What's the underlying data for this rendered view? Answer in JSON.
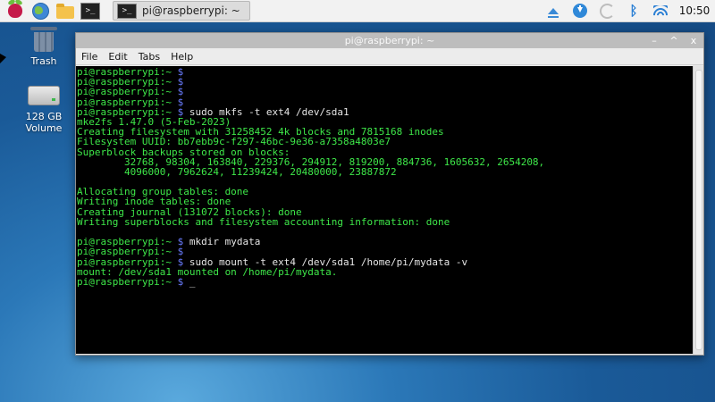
{
  "taskbar": {
    "launchers": [
      "raspberry-pi-menu",
      "web-browser",
      "file-manager",
      "terminal"
    ],
    "task_button_label": "pi@raspberrypi: ~",
    "terminal_glyph": ">_",
    "clock": "10:50"
  },
  "desktop": {
    "trash_label": "Trash",
    "volume_label_line1": "128 GB",
    "volume_label_line2": "Volume"
  },
  "window": {
    "title": "pi@raspberrypi: ~",
    "controls": [
      "–",
      "^",
      "x"
    ],
    "menu": [
      "File",
      "Edit",
      "Tabs",
      "Help"
    ]
  },
  "terminal": {
    "lines": [
      {
        "prompt": "pi@raspberrypi:~ ",
        "dollar": "$",
        "cmd": ""
      },
      {
        "prompt": "pi@raspberrypi:~ ",
        "dollar": "$",
        "cmd": ""
      },
      {
        "prompt": "pi@raspberrypi:~ ",
        "dollar": "$",
        "cmd": ""
      },
      {
        "prompt": "pi@raspberrypi:~ ",
        "dollar": "$",
        "cmd": ""
      },
      {
        "prompt": "pi@raspberrypi:~ ",
        "dollar": "$",
        "cmd": " sudo mkfs -t ext4 /dev/sda1"
      },
      {
        "text": "mke2fs 1.47.0 (5-Feb-2023)"
      },
      {
        "text": "Creating filesystem with 31258452 4k blocks and 7815168 inodes"
      },
      {
        "text": "Filesystem UUID: bb7ebb9c-f297-46bc-9e36-a7358a4803e7"
      },
      {
        "text": "Superblock backups stored on blocks:"
      },
      {
        "text": "        32768, 98304, 163840, 229376, 294912, 819200, 884736, 1605632, 2654208,"
      },
      {
        "text": "        4096000, 7962624, 11239424, 20480000, 23887872"
      },
      {
        "text": ""
      },
      {
        "text": "Allocating group tables: done"
      },
      {
        "text": "Writing inode tables: done"
      },
      {
        "text": "Creating journal (131072 blocks): done"
      },
      {
        "text": "Writing superblocks and filesystem accounting information: done"
      },
      {
        "text": ""
      },
      {
        "prompt": "pi@raspberrypi:~ ",
        "dollar": "$",
        "cmd": " mkdir mydata"
      },
      {
        "prompt": "pi@raspberrypi:~ ",
        "dollar": "$",
        "cmd": ""
      },
      {
        "prompt": "pi@raspberrypi:~ ",
        "dollar": "$",
        "cmd": " sudo mount -t ext4 /dev/sda1 /home/pi/mydata -v"
      },
      {
        "text": "mount: /dev/sda1 mounted on /home/pi/mydata."
      },
      {
        "prompt": "pi@raspberrypi:~ ",
        "dollar": "$",
        "cmd": " _"
      }
    ]
  }
}
